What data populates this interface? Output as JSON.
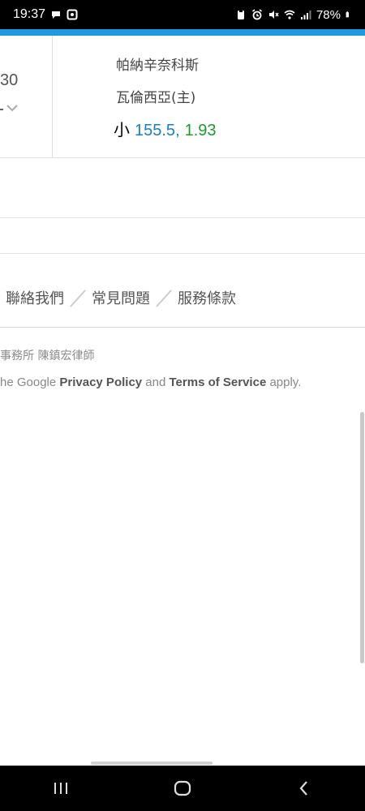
{
  "status_bar": {
    "time": "19:37",
    "battery": "78%"
  },
  "colors": {
    "accent_bar": "#1e9be0",
    "odds_blue": "#1a7fc1",
    "odds_green": "#1c9b2e"
  },
  "match": {
    "left_partial_number": "30",
    "home_team": "帕納辛奈科斯",
    "away_team": "瓦倫西亞(主)",
    "ou_label": "小",
    "line": "155.5",
    "separator": ",",
    "odds": "1.93"
  },
  "footer": {
    "links": [
      "聯絡我們",
      "常見問題",
      "服務條款"
    ],
    "law_firm": "事務所 陳鎮宏律師",
    "recaptcha_prefix": "he Google ",
    "privacy_policy": "Privacy Policy",
    "and": " and ",
    "terms_of_service": "Terms of Service",
    "apply": " apply."
  }
}
